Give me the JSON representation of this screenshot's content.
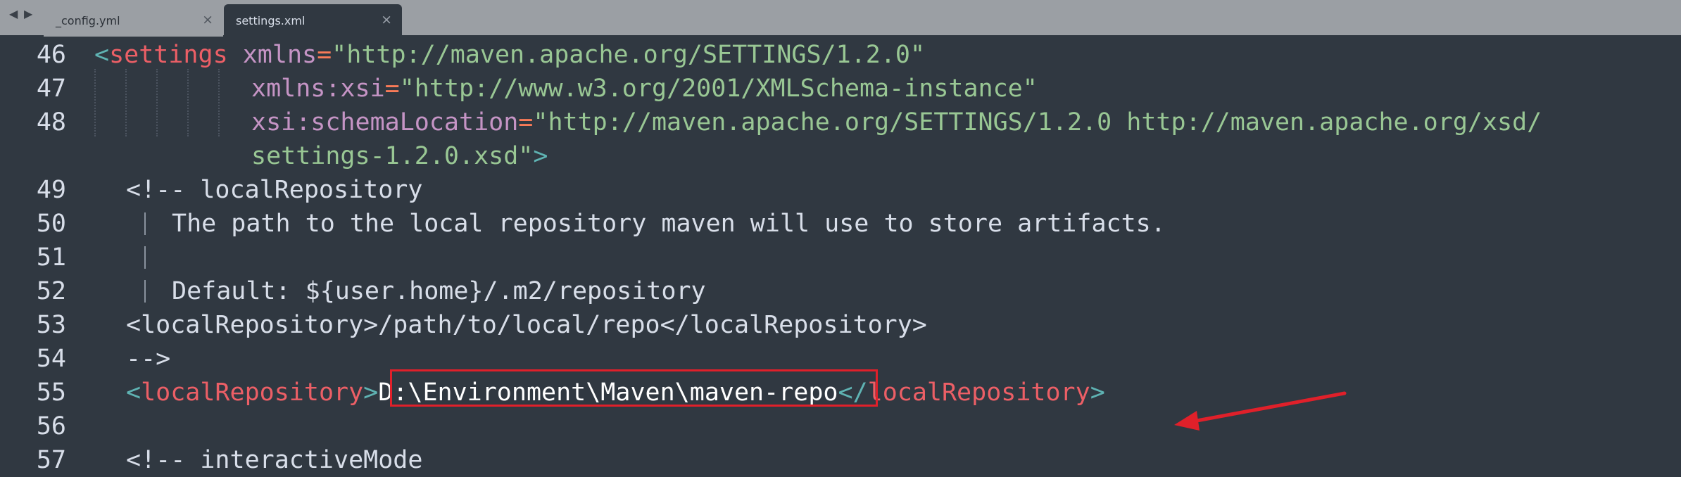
{
  "tabs": [
    {
      "label": "_config.yml",
      "active": false
    },
    {
      "label": "settings.xml",
      "active": true
    }
  ],
  "icons": {
    "nav_back": "triangle-left",
    "nav_forward": "triangle-right",
    "tab_close": "×"
  },
  "colors": {
    "background": "#303841",
    "tabbar": "#9b9fa4",
    "tag": "#ec5f66",
    "attribute": "#c594c5",
    "string": "#99c794",
    "punctuation": "#5fb3b3",
    "annotation": "#e0202a"
  },
  "lines": {
    "l46": {
      "num": "46",
      "open": "<",
      "tag": "settings",
      "attr": "xmlns",
      "eq": "=",
      "val": "\"http://maven.apache.org/SETTINGS/1.2.0\""
    },
    "l47": {
      "num": "47",
      "attr": "xmlns:xsi",
      "eq": "=",
      "val": "\"http://www.w3.org/2001/XMLSchema-instance\""
    },
    "l48": {
      "num": "48",
      "attr": "xsi:schemaLocation",
      "eq": "=",
      "val": "\"http://maven.apache.org/SETTINGS/1.2.0 http://maven.apache.org/xsd/",
      "wrap_val": "settings-1.2.0.xsd\"",
      "close": ">"
    },
    "l49": {
      "num": "49",
      "text": "<!-- localRepository"
    },
    "l50": {
      "num": "50",
      "text": "The path to the local repository maven will use to store artifacts."
    },
    "l51": {
      "num": "51"
    },
    "l52": {
      "num": "52",
      "text": "Default: ${user.home}/.m2/repository"
    },
    "l53": {
      "num": "53",
      "text": "<localRepository>/path/to/local/repo</localRepository>"
    },
    "l54": {
      "num": "54",
      "text": "-->"
    },
    "l55": {
      "num": "55",
      "open": "<",
      "tag": "localRepository",
      "gt": ">",
      "value": "D:\\Environment\\Maven\\maven-repo",
      "close_open": "</",
      "close_tag": "localRepository",
      "close_gt": ">"
    },
    "l56": {
      "num": "56"
    },
    "l57": {
      "num": "57",
      "text": "<!-- interactiveMode"
    }
  }
}
